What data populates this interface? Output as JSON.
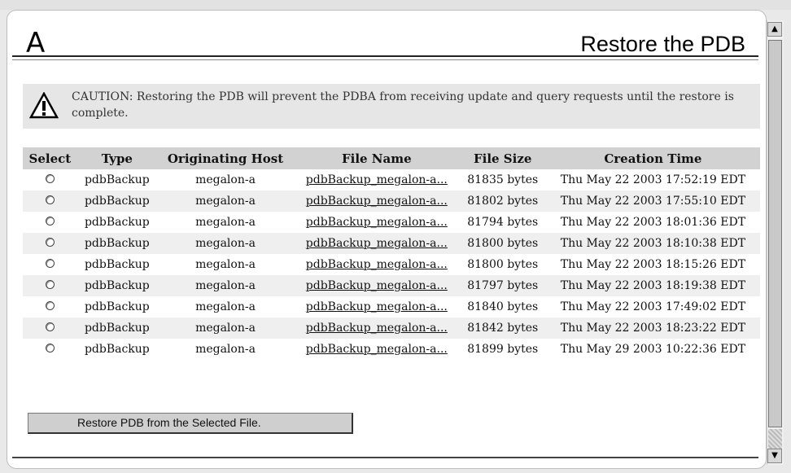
{
  "header": {
    "logo": "A",
    "title": "Restore the PDB"
  },
  "caution": {
    "icon": "warning-icon",
    "text": "CAUTION: Restoring the PDB will prevent the PDBA from receiving update and query requests until the restore is complete."
  },
  "table": {
    "columns": [
      "Select",
      "Type",
      "Originating Host",
      "File Name",
      "File Size",
      "Creation Time"
    ],
    "rows": [
      {
        "type": "pdbBackup",
        "host": "megalon-a",
        "file": "pdbBackup_megalon-a...",
        "size": "81835 bytes",
        "created": "Thu May 22 2003 17:52:19 EDT"
      },
      {
        "type": "pdbBackup",
        "host": "megalon-a",
        "file": "pdbBackup_megalon-a...",
        "size": "81802 bytes",
        "created": "Thu May 22 2003 17:55:10 EDT"
      },
      {
        "type": "pdbBackup",
        "host": "megalon-a",
        "file": "pdbBackup_megalon-a...",
        "size": "81794 bytes",
        "created": "Thu May 22 2003 18:01:36 EDT"
      },
      {
        "type": "pdbBackup",
        "host": "megalon-a",
        "file": "pdbBackup_megalon-a...",
        "size": "81800 bytes",
        "created": "Thu May 22 2003 18:10:38 EDT"
      },
      {
        "type": "pdbBackup",
        "host": "megalon-a",
        "file": "pdbBackup_megalon-a...",
        "size": "81800 bytes",
        "created": "Thu May 22 2003 18:15:26 EDT"
      },
      {
        "type": "pdbBackup",
        "host": "megalon-a",
        "file": "pdbBackup_megalon-a...",
        "size": "81797 bytes",
        "created": "Thu May 22 2003 18:19:38 EDT"
      },
      {
        "type": "pdbBackup",
        "host": "megalon-a",
        "file": "pdbBackup_megalon-a...",
        "size": "81840 bytes",
        "created": "Thu May 22 2003 17:49:02 EDT"
      },
      {
        "type": "pdbBackup",
        "host": "megalon-a",
        "file": "pdbBackup_megalon-a...",
        "size": "81842 bytes",
        "created": "Thu May 22 2003 18:23:22 EDT"
      },
      {
        "type": "pdbBackup",
        "host": "megalon-a",
        "file": "pdbBackup_megalon-a...",
        "size": "81899 bytes",
        "created": "Thu May 29 2003 10:22:36 EDT"
      }
    ]
  },
  "actions": {
    "restore_label": "Restore PDB from the Selected File."
  },
  "scrollbar": {
    "up_icon": "arrow-up-icon",
    "down_icon": "arrow-down-icon"
  }
}
